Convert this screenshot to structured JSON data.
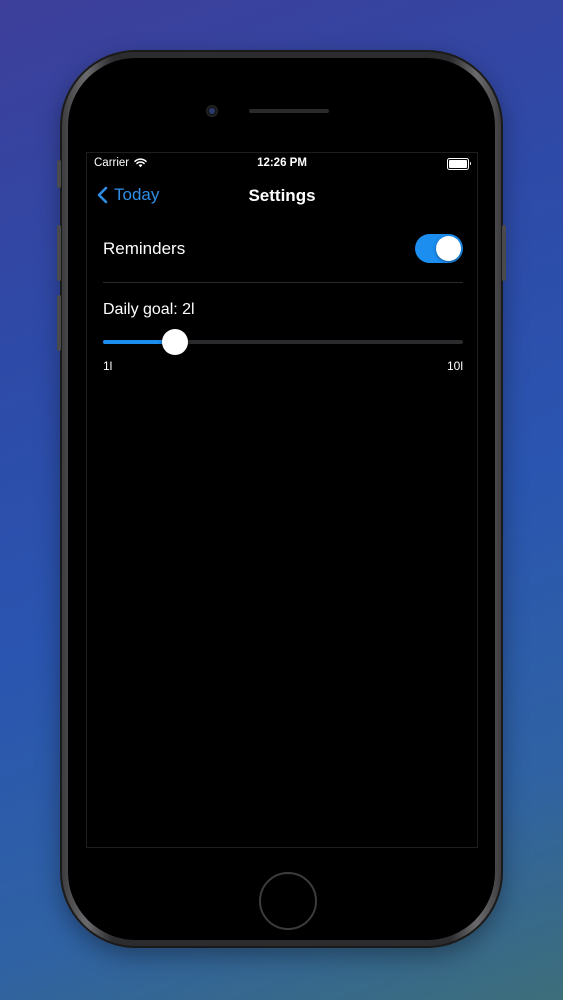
{
  "status_bar": {
    "carrier": "Carrier",
    "time": "12:26 PM",
    "wifi_icon": "wifi-icon",
    "battery_icon": "battery-icon"
  },
  "nav": {
    "back_label": "Today",
    "back_icon": "chevron-left-icon",
    "title": "Settings"
  },
  "settings": {
    "reminders": {
      "label": "Reminders",
      "enabled": true
    },
    "daily_goal": {
      "label": "Daily goal: 2l",
      "value": 2,
      "min_label": "1l",
      "max_label": "10l",
      "min": 1,
      "max": 10
    }
  },
  "colors": {
    "accent": "#1b8ef0",
    "link": "#2f8ee6",
    "background": "#000000"
  }
}
